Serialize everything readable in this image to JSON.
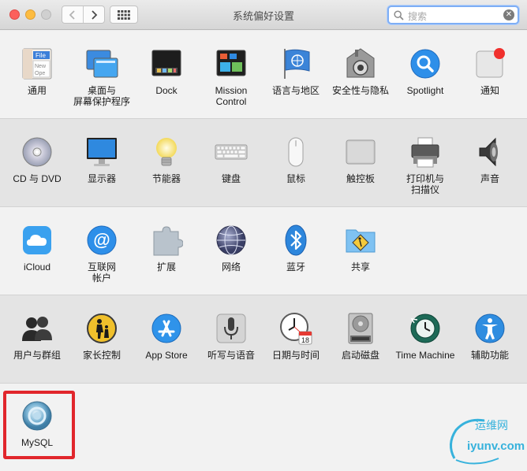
{
  "window": {
    "title": "系统偏好设置",
    "search_placeholder": "搜索"
  },
  "sections": [
    {
      "items": [
        {
          "label": "通用",
          "icon": "general-icon"
        },
        {
          "label": "桌面与\n屏幕保护程序",
          "icon": "desktop-screensaver-icon"
        },
        {
          "label": "Dock",
          "icon": "dock-icon"
        },
        {
          "label": "Mission\nControl",
          "icon": "mission-control-icon"
        },
        {
          "label": "语言与地区",
          "icon": "language-region-icon"
        },
        {
          "label": "安全性与隐私",
          "icon": "security-privacy-icon"
        },
        {
          "label": "Spotlight",
          "icon": "spotlight-icon"
        },
        {
          "label": "通知",
          "icon": "notifications-icon"
        }
      ]
    },
    {
      "items": [
        {
          "label": "CD 与 DVD",
          "icon": "cd-dvd-icon"
        },
        {
          "label": "显示器",
          "icon": "displays-icon"
        },
        {
          "label": "节能器",
          "icon": "energy-saver-icon"
        },
        {
          "label": "键盘",
          "icon": "keyboard-icon"
        },
        {
          "label": "鼠标",
          "icon": "mouse-icon"
        },
        {
          "label": "触控板",
          "icon": "trackpad-icon"
        },
        {
          "label": "打印机与\n扫描仪",
          "icon": "printers-scanners-icon"
        },
        {
          "label": "声音",
          "icon": "sound-icon"
        }
      ]
    },
    {
      "items": [
        {
          "label": "iCloud",
          "icon": "icloud-icon"
        },
        {
          "label": "互联网\n帐户",
          "icon": "internet-accounts-icon"
        },
        {
          "label": "扩展",
          "icon": "extensions-icon"
        },
        {
          "label": "网络",
          "icon": "network-icon"
        },
        {
          "label": "蓝牙",
          "icon": "bluetooth-icon"
        },
        {
          "label": "共享",
          "icon": "sharing-icon"
        }
      ]
    },
    {
      "items": [
        {
          "label": "用户与群组",
          "icon": "users-groups-icon"
        },
        {
          "label": "家长控制",
          "icon": "parental-controls-icon"
        },
        {
          "label": "App Store",
          "icon": "app-store-icon"
        },
        {
          "label": "听写与语音",
          "icon": "dictation-speech-icon"
        },
        {
          "label": "日期与时间",
          "icon": "date-time-icon"
        },
        {
          "label": "启动磁盘",
          "icon": "startup-disk-icon"
        },
        {
          "label": "Time Machine",
          "icon": "time-machine-icon"
        },
        {
          "label": "辅助功能",
          "icon": "accessibility-icon"
        }
      ]
    },
    {
      "items": [
        {
          "label": "MySQL",
          "icon": "mysql-icon"
        }
      ]
    }
  ],
  "general_icon_text": {
    "line1": "File",
    "line2": "New",
    "line3": "Ope"
  },
  "date_icon_day": "18",
  "watermark": {
    "line1": "运维网",
    "line2": "iyunv.com"
  }
}
